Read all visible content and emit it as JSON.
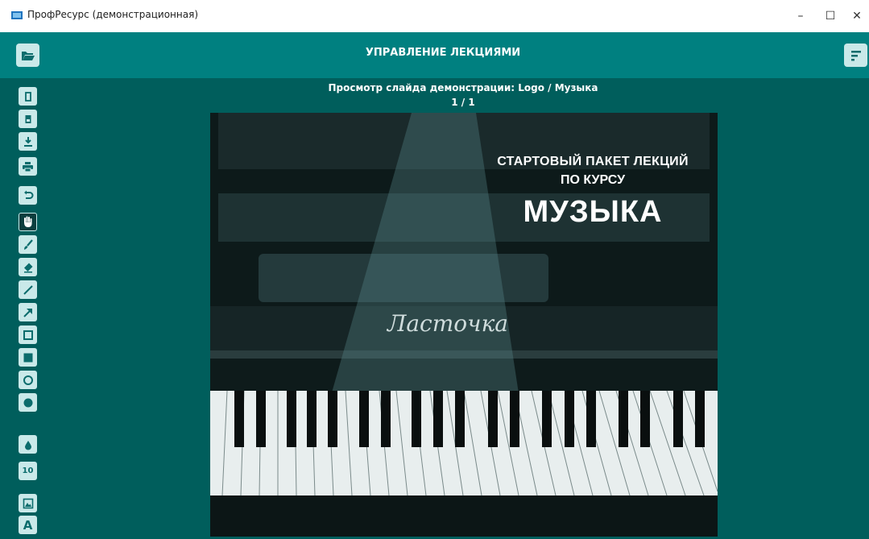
{
  "window": {
    "title": "ПрофРесурс (демонстрационная)",
    "minimize": "–",
    "maximize": "☐",
    "close": "✕"
  },
  "header": {
    "title": "УПРАВЛЕНИЕ ЛЕКЦИЯМИ",
    "left_icon": "folder-open-icon",
    "right_icon": "sort-menu-icon"
  },
  "toolbar": {
    "items": [
      {
        "icon": "blank-page-icon"
      },
      {
        "icon": "page-template-icon"
      },
      {
        "icon": "download-icon"
      },
      {
        "icon": "print-icon"
      },
      {
        "icon": "undo-icon"
      },
      {
        "icon": "hand-pan-icon",
        "active": true
      },
      {
        "icon": "brush-icon"
      },
      {
        "icon": "eraser-icon"
      },
      {
        "icon": "line-icon"
      },
      {
        "icon": "arrow-icon"
      },
      {
        "icon": "rectangle-outline-icon"
      },
      {
        "icon": "rectangle-filled-icon"
      },
      {
        "icon": "circle-outline-icon"
      },
      {
        "icon": "circle-filled-icon"
      },
      {
        "icon": "color-drop-icon"
      },
      {
        "icon": "line-width-icon",
        "label": "10"
      },
      {
        "icon": "insert-image-icon"
      },
      {
        "icon": "text-tool-icon",
        "label": "A"
      }
    ]
  },
  "preview": {
    "title": "Просмотр слайда демонстрации: Logo / Музыка",
    "page": "1 / 1"
  },
  "slide": {
    "line1": "СТАРТОВЫЙ ПАКЕТ ЛЕКЦИЙ",
    "line2": "ПО КУРСУ",
    "big": "МУЗЫКА",
    "brand": "Ласточка"
  },
  "colors": {
    "header": "#008080",
    "main_bg": "#005e5c",
    "tool_bg": "#c9e9e9",
    "tool_icon": "#0b6c6c",
    "tool_active": "#0b3e3e"
  }
}
